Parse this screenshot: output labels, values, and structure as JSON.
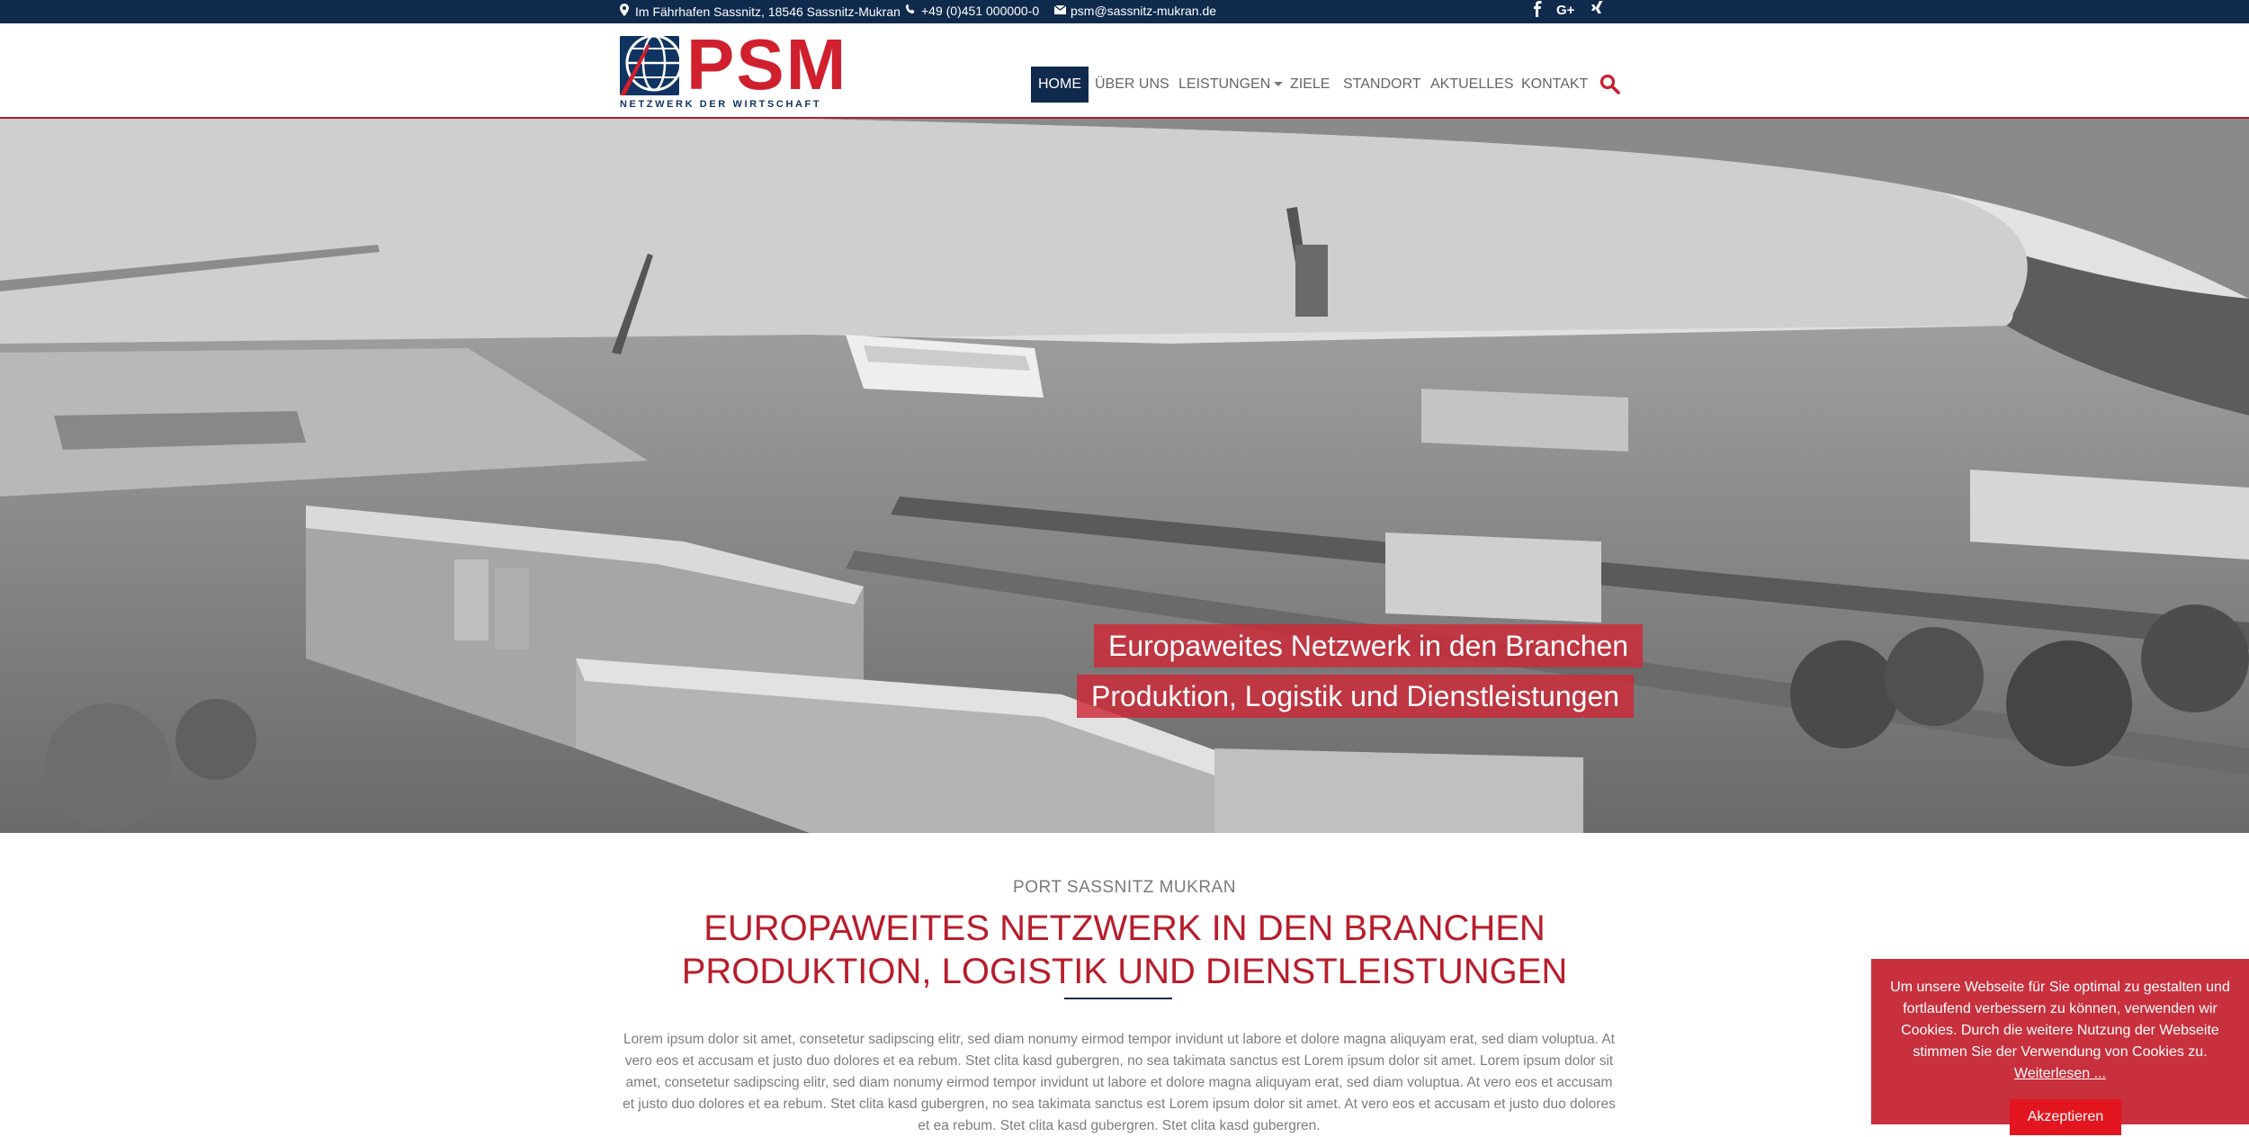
{
  "topbar": {
    "address": "Im Fährhafen Sassnitz, 18546 Sassnitz-Mukran",
    "phone": "+49 (0)451 000000-0",
    "email": "psm@sassnitz-mukran.de",
    "social": [
      "facebook-icon",
      "google-plus-icon",
      "xing-icon"
    ]
  },
  "brand": {
    "word": "PSM",
    "tagline": "NETZWERK DER WIRTSCHAFT",
    "colors": {
      "navy": "#0f2a4d",
      "red": "#d0202e"
    }
  },
  "nav": {
    "items": [
      "HOME",
      "ÜBER UNS",
      "LEISTUNGEN",
      "ZIELE",
      "STANDORT",
      "AKTUELLES",
      "KONTAKT"
    ],
    "active": "HOME"
  },
  "hero": {
    "line1": "Europaweites Netzwerk in den Branchen",
    "line2": "Produktion, Logistik und Dienstleistungen"
  },
  "intro": {
    "kicker": "PORT SASSNITZ MUKRAN",
    "headline1": "EUROPAWEITES NETZWERK IN DEN BRANCHEN",
    "headline2": "PRODUKTION, LOGISTIK UND DIENSTLEISTUNGEN",
    "body": "Lorem ipsum dolor sit amet, consetetur sadipscing elitr, sed diam nonumy eirmod tempor invidunt ut labore et dolore magna aliquyam erat, sed diam voluptua. At vero eos et accusam et justo duo dolores et ea rebum. Stet clita kasd gubergren, no sea takimata sanctus est Lorem ipsum dolor sit amet. Lorem ipsum dolor sit amet, consetetur sadipscing elitr, sed diam nonumy eirmod tempor invidunt ut labore et dolore magna aliquyam erat, sed diam voluptua. At vero eos et accusam et justo duo dolores et ea rebum. Stet clita kasd gubergren, no sea takimata sanctus est Lorem ipsum dolor sit amet. At vero eos et accusam et justo duo dolores et ea rebum. Stet clita kasd gubergren. Stet clita kasd gubergren."
  },
  "cookie": {
    "text": "Um unsere Webseite für Sie optimal zu gestalten und fortlaufend verbessern zu können, verwenden wir Cookies. Durch die weitere Nutzung der Webseite stimmen Sie der Verwendung von Cookies zu.",
    "link": "Weiterlesen ...",
    "button": "Akzeptieren"
  }
}
